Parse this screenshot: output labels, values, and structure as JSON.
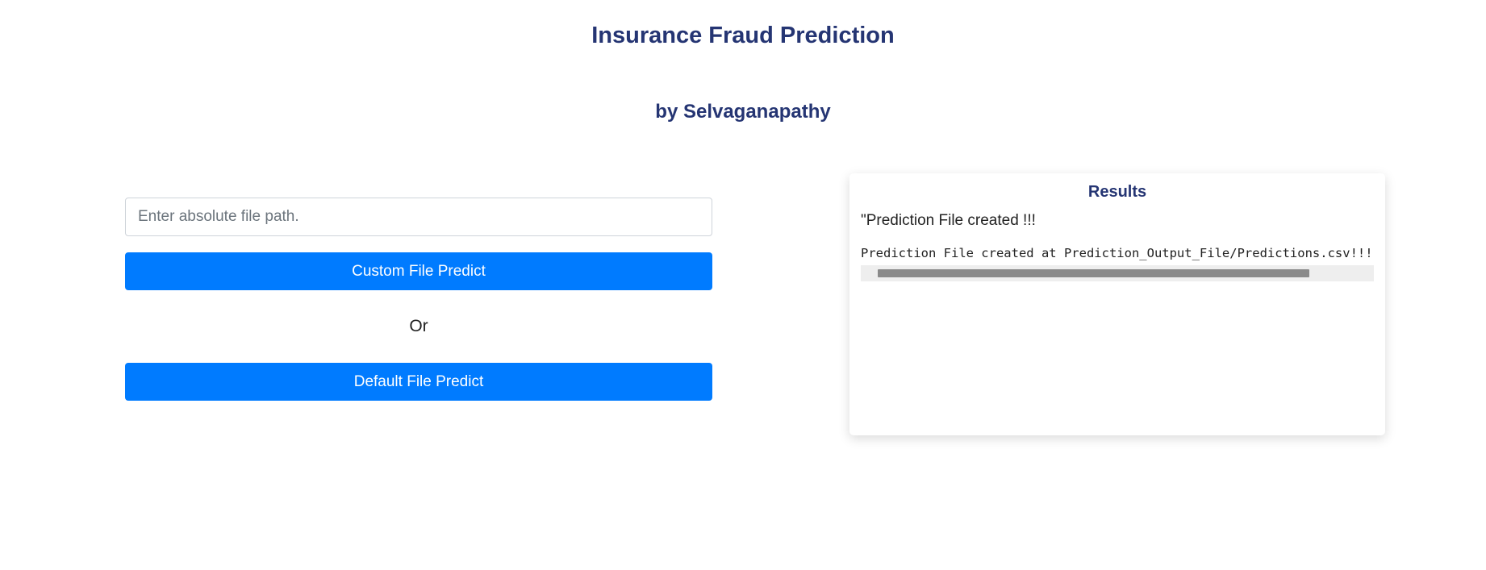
{
  "header": {
    "title": "Insurance Fraud Prediction",
    "subtitle": "by Selvaganapathy"
  },
  "form": {
    "path_input": {
      "value": "",
      "placeholder": "Enter absolute file path."
    },
    "custom_button_label": "Custom File Predict",
    "or_label": "Or",
    "default_button_label": "Default File Predict"
  },
  "results": {
    "title": "Results",
    "message": "\"Prediction File created !!!",
    "output": "Prediction File created at Prediction_Output_File/Predictions.csv!!!",
    "scrollbar_visible_fraction": 0.9
  },
  "colors": {
    "heading": "#253573",
    "primary_button": "#007bff"
  }
}
